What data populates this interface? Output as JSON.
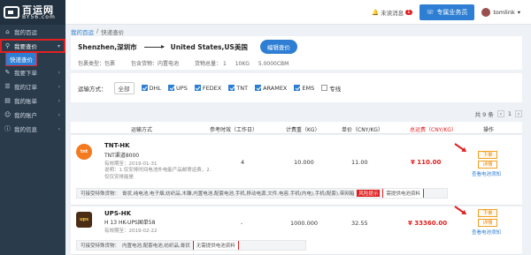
{
  "brand": {
    "name": "百运网",
    "sub": "BY56.com"
  },
  "sidebar": {
    "items": [
      {
        "label": "我的百运",
        "icon": "home-icon"
      },
      {
        "label": "我要查价",
        "icon": "search-icon"
      },
      {
        "label": "我要下单",
        "icon": "edit-icon"
      },
      {
        "label": "我的订单",
        "icon": "list-icon"
      },
      {
        "label": "我的账单",
        "icon": "bill-icon"
      },
      {
        "label": "我的账户",
        "icon": "user-icon"
      },
      {
        "label": "我的信息",
        "icon": "info-icon"
      }
    ],
    "sub_item": "快递查价"
  },
  "topbar": {
    "messages_label": "未读消息",
    "messages_count": "1",
    "service_label": "专属业务员",
    "username": "tomlink"
  },
  "breadcrumb": {
    "home": "我的百运",
    "sep": "/",
    "current": "快递查价"
  },
  "route": {
    "origin": "Shenzhen,深圳市",
    "destination": "United States,US美国",
    "edit_label": "编辑查价",
    "package_type": "包裹类型：包裹",
    "goods": "包含货物：内置电池",
    "total_weight": "货物总量：",
    "qty": "1",
    "weight": "10KG",
    "volume": "5.0000CBM"
  },
  "carriers": {
    "label": "运输方式：",
    "all_label": "全部",
    "options": [
      {
        "label": "DHL",
        "checked": true
      },
      {
        "label": "UPS",
        "checked": true
      },
      {
        "label": "FEDEX",
        "checked": true
      },
      {
        "label": "TNT",
        "checked": true
      },
      {
        "label": "ARAMEX",
        "checked": true
      },
      {
        "label": "EMS",
        "checked": true
      },
      {
        "label": "专线",
        "checked": false
      }
    ]
  },
  "pager": {
    "summary": "共 9 条",
    "page": "1"
  },
  "table": {
    "headers": [
      "运输方式",
      "参考时效（工作日）",
      "计费重（KG）",
      "单价（CNY/KG）",
      "总运费（CNY/KG）",
      "操作"
    ]
  },
  "rows": [
    {
      "logo_text": "tnt",
      "name": "TNT-HK",
      "sub": "TNT渠道8000",
      "valid": "有效期至：2019-01-31",
      "note": "说明：1.仅安排时间电池外电能产品邮寄运费，2.仅仅安排能是",
      "time": "4",
      "weight": "10.000",
      "unit_price": "11.00",
      "total": "¥ 110.00",
      "order_label": "下单",
      "detail_label": "详情",
      "elec_link": "查看电池须知",
      "goods_label": "可接受特殊货物：",
      "goods": "膏状,纯电池,电子烟,纺织品,木雕,内置电池,配套电池,手机,移动电源,文件,电容,手机(内电),手机(配套),带网箱",
      "risk_label": "风险提示",
      "req_label": "需提供电池资料"
    },
    {
      "logo_text": "ups",
      "name": "UPS-HK",
      "sub": "H 13 HK-UPS国单58",
      "valid": "有效期至：2019-02-22",
      "time": "-",
      "weight": "1000.000",
      "unit_price": "32.55",
      "total": "¥ 33360.00",
      "order_label": "下单",
      "detail_label": "详情",
      "elec_link": "查看电池须知",
      "goods_label": "可接受特殊货物：",
      "goods": "内置电池,配套电池,纺织品,膏状",
      "req_label": "无需提供电池资料"
    }
  ],
  "colors": {
    "primary": "#2e7fd3",
    "danger": "#e02020",
    "warning": "#f08000",
    "sidebar": "#2a3b4c"
  }
}
